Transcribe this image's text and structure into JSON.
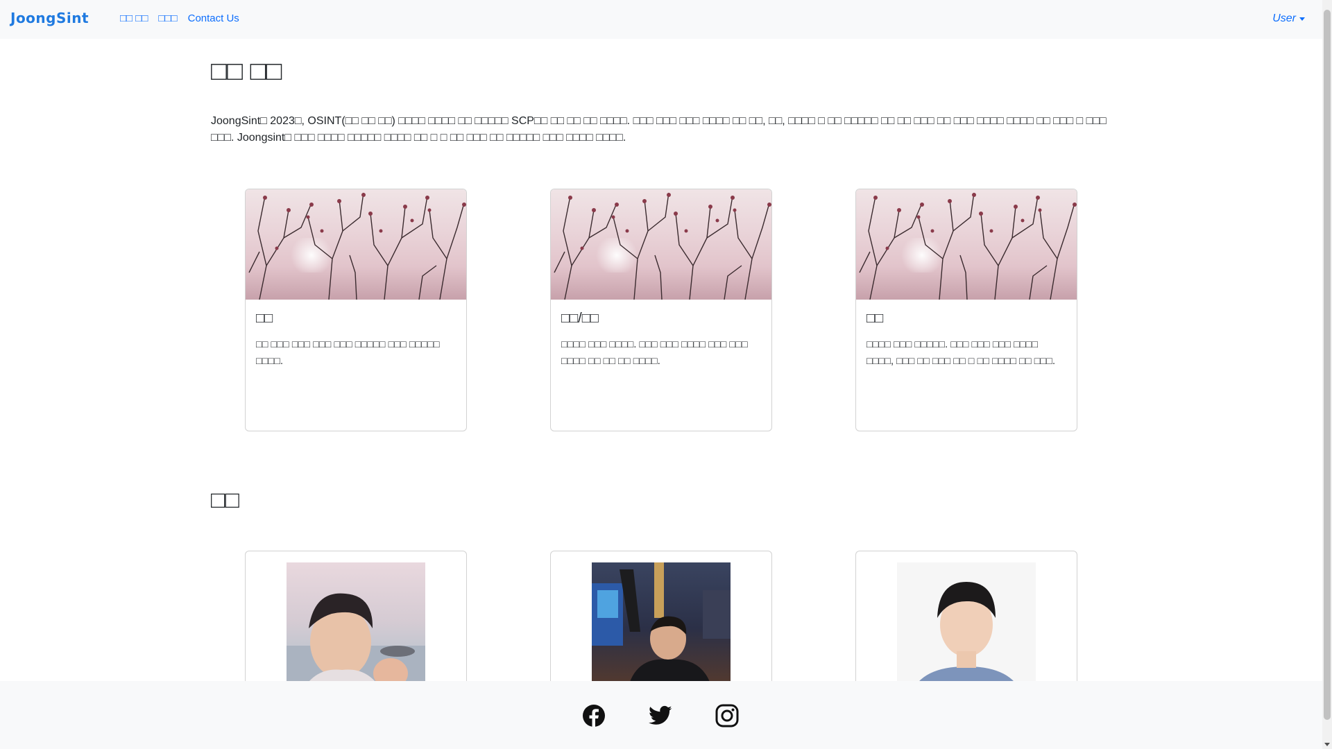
{
  "navbar": {
    "brand": "JoongSint",
    "links": [
      "□□ □□",
      "□□□",
      "Contact Us"
    ],
    "user_label": "User"
  },
  "main": {
    "title": "□□ □□",
    "intro": "JoongSint□ 2023□, OSINT(□□ □□ □□) □□□□ □□□□ □□ □□□□□ SCP□□ □□ □□ □□ □□□□. □□□ □□□ □□□ □□□□ □□ □□, □□, □□□□ □ □□ □□□□□ □□ □□ □□□ □□ □□□ □□□□ □□□□ □□ □□□ □ □□□ □□□. Joongsint□ □□□ □□□□ □□□□□ □□□□ □□ □ □ □□ □□□ □□ □□□□□ □□□ □□□□ □□□□.",
    "services": [
      {
        "title": "□□",
        "text": "□□ □□□ □□□ □□□ □□□ □□□□□ □□□ □□□□□ □□□□."
      },
      {
        "title": "□□/□□",
        "text": "□□□□ □□□ □□□□. □□□ □□□ □□□□ □□□ □□□ □□□□ □□ □□ □□ □□□□."
      },
      {
        "title": "□□",
        "text": "□□□□ □□□ □□□□□. □□□ □□□ □□□ □□□□ □□□□, □□□ □□ □□□ □□ □ □□ □□□□ □□ □□□."
      }
    ],
    "members_title": "□□"
  },
  "footer": {
    "icons": [
      "facebook-icon",
      "twitter-icon",
      "instagram-icon"
    ]
  },
  "colors": {
    "brand": "#1f7ae0",
    "link": "#0d6efd",
    "navbar_bg": "#f8f9fa"
  }
}
